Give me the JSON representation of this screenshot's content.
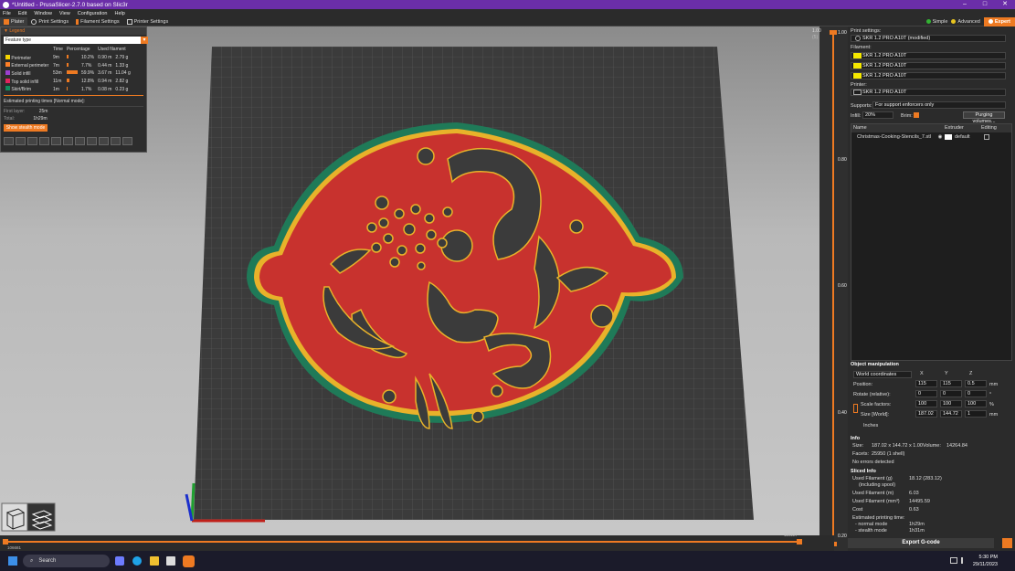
{
  "window": {
    "title": "*Untitled - PrusaSlicer-2.7.0 based on Slic3r",
    "minimize": "–",
    "maximize": "□",
    "close": "✕"
  },
  "menu": [
    "File",
    "Edit",
    "Window",
    "View",
    "Configuration",
    "Help"
  ],
  "tabs": [
    {
      "label": "Plater",
      "icon": "plater-icon"
    },
    {
      "label": "Print Settings",
      "icon": "gear-icon"
    },
    {
      "label": "Filament Settings",
      "icon": "filament-icon"
    },
    {
      "label": "Printer Settings",
      "icon": "printer-icon"
    }
  ],
  "modes": {
    "simple": "Simple",
    "advanced": "Advanced",
    "expert": "Expert"
  },
  "colors": {
    "accent": "#ee7a22",
    "simple": "#33b233",
    "advanced": "#e8c41f",
    "expert": "#ee7a22",
    "titlebar": "#6b2ea8",
    "bed": "#3a3a3a",
    "model_fill": "#c8322e",
    "model_outline": "#e8b22a",
    "model_border": "#1f7a58"
  },
  "legend": {
    "header": "Legend",
    "feature_select": "Feature type",
    "columns": [
      "Time",
      "Percentage",
      "Used filament"
    ],
    "rows": [
      {
        "name": "Perimeter",
        "time": "9m",
        "pct": "10.2%",
        "len": "0.90 m",
        "weight": "2.79 g",
        "color": "#f5d400",
        "frac": 0.102
      },
      {
        "name": "External perimeter",
        "time": "7m",
        "pct": "7.7%",
        "len": "0.44 m",
        "weight": "1.33 g",
        "color": "#ff7f27",
        "frac": 0.077
      },
      {
        "name": "Solid infill",
        "time": "53m",
        "pct": "59.9%",
        "len": "3.67 m",
        "weight": "11.04 g",
        "color": "#9b3fd0",
        "frac": 0.599
      },
      {
        "name": "Top solid infill",
        "time": "11m",
        "pct": "12.8%",
        "len": "0.94 m",
        "weight": "2.82 g",
        "color": "#e0245e",
        "frac": 0.128
      },
      {
        "name": "Skirt/Brim",
        "time": "1m",
        "pct": "1.7%",
        "len": "0.08 m",
        "weight": "0.23 g",
        "color": "#0f8e5e",
        "frac": 0.017
      }
    ],
    "estimated_title": "Estimated printing times [Normal mode]:",
    "first_layer_label": "First layer:",
    "first_layer": "25m",
    "total_label": "Total:",
    "total": "1h29m",
    "stealth_button": "Show stealth mode"
  },
  "vslider": {
    "top_label": "1.00",
    "top_sub": "(5)",
    "ticks": [
      "1.00",
      "0.80",
      "0.60",
      "0.40",
      "0.20"
    ],
    "bottom_label": "0.20"
  },
  "hslider": {
    "left_value": "106681",
    "right_value": "128227"
  },
  "right_panel": {
    "print_settings_label": "Print settings:",
    "print_profile": "SKR 1.2 PRO A10T (modified)",
    "filament_label": "Filament:",
    "filaments": [
      {
        "name": "SKR 1.2 PRO A10T",
        "color": "#f5e800"
      },
      {
        "name": "SKR 1.2 PRO A10T",
        "color": "#f5e800"
      },
      {
        "name": "SKR 1.2 PRO A10T",
        "color": "#f5e800"
      }
    ],
    "printer_label": "Printer:",
    "printer_profile": "SKR 1.2 PRO A10T",
    "supports_label": "Supports:",
    "supports_value": "For support enforcers only",
    "infill_label": "Infill:",
    "infill_value": "20%",
    "brim_label": "Brim:",
    "purging_button": "Purging volumes...",
    "object_list_headers": [
      "Name",
      "Extruder",
      "Editing"
    ],
    "object_name": "Christmas-Cooking-Stencils_7.stl",
    "object_extruder": "default",
    "object_manipulation": "Object manipulation",
    "coords_select": "World coordinates",
    "axes": [
      "X",
      "Y",
      "Z"
    ],
    "position_label": "Position:",
    "position": [
      "115",
      "115",
      "0.5"
    ],
    "position_unit": "mm",
    "rotate_label": "Rotate (relative):",
    "rotate": [
      "0",
      "0",
      "0"
    ],
    "rotate_unit": "°",
    "scale_label": "Scale factors:",
    "scale": [
      "100",
      "100",
      "100"
    ],
    "scale_unit": "%",
    "size_label": "Size [World]:",
    "size": [
      "187.02",
      "144.72",
      "1"
    ],
    "size_unit": "mm",
    "inches_label": "Inches",
    "info_title": "Info",
    "info_size_label": "Size:",
    "info_size": "187.02 x 144.72 x 1.00",
    "info_volume_label": "Volume:",
    "info_volume": "14264.84",
    "info_facets_label": "Facets:",
    "info_facets": "25950 (1 shell)",
    "info_errors": "No errors detected",
    "sliced_title": "Sliced Info",
    "sliced": [
      {
        "label": "Used Filament (g)",
        "value": "18.12 (283.12)"
      },
      {
        "label": "(including spool)",
        "value": ""
      },
      {
        "label": "Used Filament (m)",
        "value": "6.03"
      },
      {
        "label": "Used Filament (mm³)",
        "value": "14495.59"
      },
      {
        "label": "Cost",
        "value": "0.63"
      },
      {
        "label": "Estimated printing time:",
        "value": ""
      },
      {
        "label": "- normal mode",
        "value": "1h29m"
      },
      {
        "label": "- stealth mode",
        "value": "1h31m"
      }
    ],
    "export_button": "Export G-code"
  },
  "taskbar": {
    "search_placeholder": "Search",
    "time": "5:30 PM",
    "date": "29/11/2023"
  }
}
